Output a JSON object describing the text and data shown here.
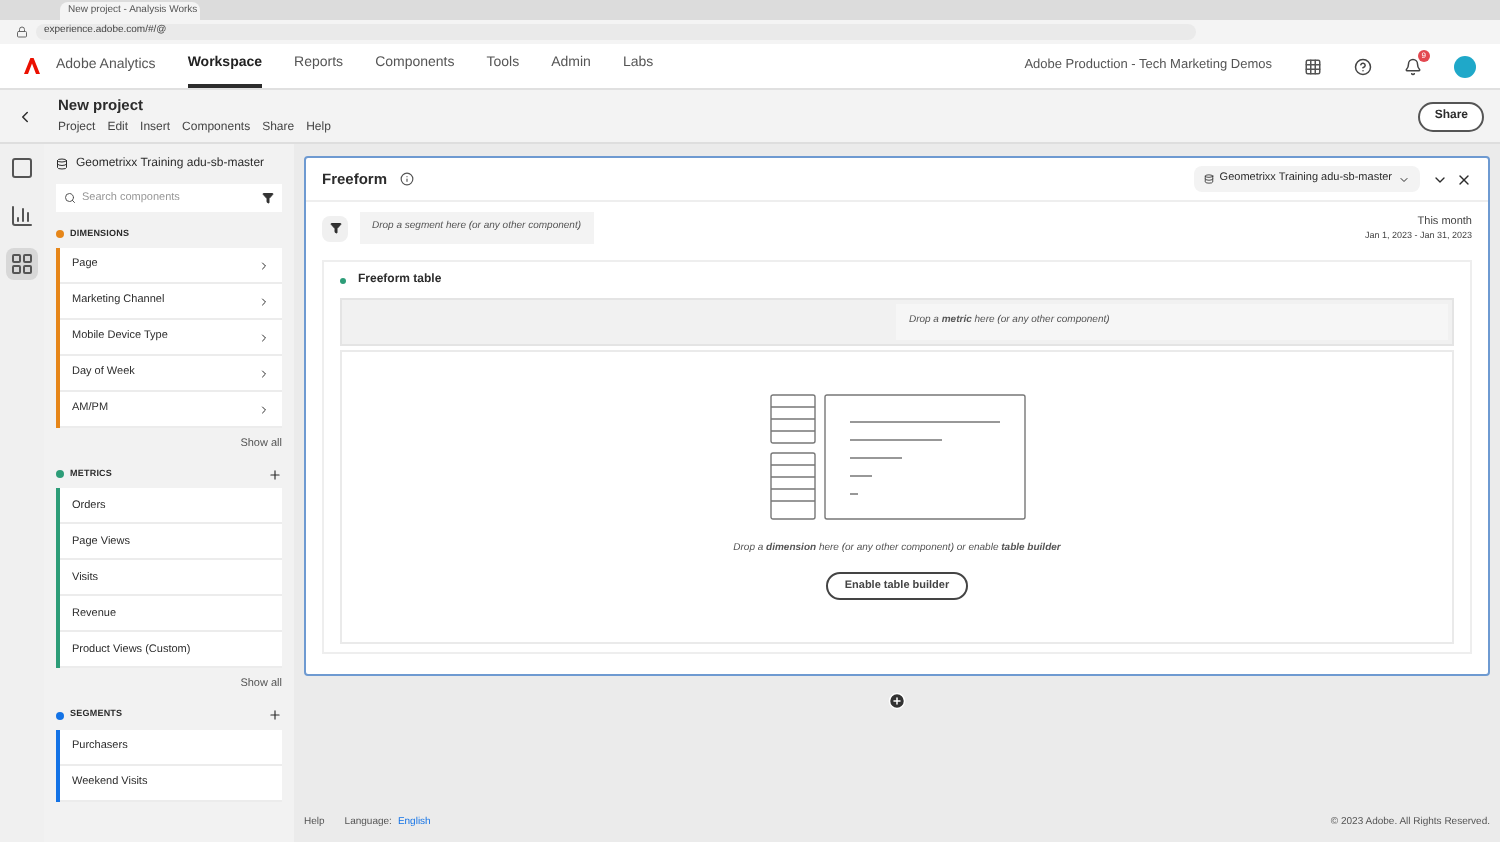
{
  "browser": {
    "tab_title": "New project - Analysis Works",
    "url": "experience.adobe.com/#/@"
  },
  "nav": {
    "product": "Adobe Analytics",
    "items": [
      {
        "label": "Workspace",
        "selected": true
      },
      {
        "label": "Reports",
        "selected": false
      },
      {
        "label": "Components",
        "selected": false
      },
      {
        "label": "Tools",
        "selected": false
      },
      {
        "label": "Admin",
        "selected": false
      },
      {
        "label": "Labs",
        "selected": false
      }
    ],
    "org": "Adobe Production - Tech Marketing Demos",
    "notification_count": "9"
  },
  "project": {
    "title": "New project",
    "menu": [
      "Project",
      "Edit",
      "Insert",
      "Components",
      "Share",
      "Help"
    ],
    "share": "Share"
  },
  "rail": [
    {
      "kind": "panel",
      "selected": false
    },
    {
      "kind": "chart",
      "selected": false
    },
    {
      "kind": "components",
      "selected": true
    }
  ],
  "sidebar": {
    "report_suite": "Geometrixx Training adu-sb-master",
    "search_placeholder": "Search components",
    "sections": [
      {
        "title": "DIMENSIONS",
        "color": "#e68619",
        "add": false,
        "items": [
          "Page",
          "Marketing Channel",
          "Mobile Device Type",
          "Day of Week",
          "AM/PM"
        ],
        "chevrons": true,
        "show_all": "Show all"
      },
      {
        "title": "METRICS",
        "color": "#2d9d78",
        "add": true,
        "items": [
          "Orders",
          "Page Views",
          "Visits",
          "Revenue",
          "Product Views (Custom)"
        ],
        "chevrons": false,
        "show_all": "Show all"
      },
      {
        "title": "SEGMENTS",
        "color": "#1473e6",
        "add": true,
        "items": [
          "Purchasers",
          "Weekend Visits"
        ],
        "chevrons": false
      }
    ]
  },
  "panel": {
    "title": "Freeform",
    "report_suite": "Geometrixx Training adu-sb-master",
    "segment_drop": "Drop a segment here (or any other component)",
    "date_label": "This month",
    "date_range": "Jan 1, 2023 - Jan 31, 2023",
    "table": {
      "title": "Freeform table",
      "metric_drop": "Drop a **metric** here (or any other component)",
      "dimension_drop": "Drop a **dimension** here (or any other component) or enable **table builder**",
      "button": "Enable table builder"
    }
  },
  "footer": {
    "help": "Help",
    "language_label": "Language:",
    "language": "English",
    "copyright": "© 2023 Adobe. All Rights Reserved."
  }
}
